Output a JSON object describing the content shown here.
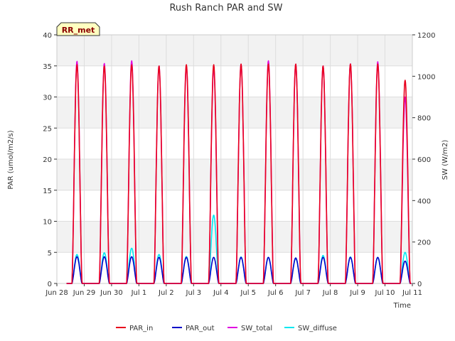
{
  "chart_data": {
    "type": "line",
    "title": "Rush Ranch PAR and SW",
    "badge": "RR_met",
    "xlabel": "Time",
    "ylabel_left": "PAR (umol/m2/s)",
    "ylabel_right": "SW (W/m2)",
    "ylim_left": [
      0,
      40
    ],
    "ylim_right": [
      0,
      1200
    ],
    "xlim_days": [
      0,
      13
    ],
    "yticks_left": [
      "0",
      "5",
      "10",
      "15",
      "20",
      "25",
      "30",
      "35",
      "40"
    ],
    "yticks_right": [
      "0",
      "200",
      "400",
      "600",
      "800",
      "1000",
      "1200"
    ],
    "xticks": [
      "Jun 28",
      "Jun 29",
      "Jun 30",
      "Jul 1",
      "Jul 2",
      "Jul 3",
      "Jul 4",
      "Jul 5",
      "Jul 6",
      "Jul 7",
      "Jul 8",
      "Jul 9",
      "Jul 10",
      "Jul 11"
    ],
    "grid": true,
    "legend_position": "bottom",
    "colors": {
      "PAR_in": "#e8001c",
      "PAR_out": "#0000c8",
      "SW_total": "#e000e0",
      "SW_diffuse": "#00e8f0",
      "band": "#f2f2f2",
      "grid": "#dddddd"
    },
    "series": [
      {
        "name": "PAR_in",
        "axis": "left",
        "daily_peak": [
          35.2,
          35.0,
          35.2,
          35.0,
          35.2,
          35.2,
          35.3,
          35.3,
          35.3,
          35.0,
          35.3,
          35.3,
          32.7
        ]
      },
      {
        "name": "PAR_out",
        "axis": "left",
        "daily_peak": [
          4.3,
          4.3,
          4.3,
          4.2,
          4.2,
          4.2,
          4.2,
          4.2,
          4.1,
          4.2,
          4.2,
          4.2,
          3.6
        ]
      },
      {
        "name": "SW_total",
        "axis": "right",
        "daily_peak": [
          1072,
          1062,
          1075,
          1050,
          1050,
          1040,
          1058,
          1075,
          1058,
          1050,
          1060,
          1070,
          900
        ]
      },
      {
        "name": "SW_diffuse",
        "axis": "right",
        "daily_peak": [
          140,
          148,
          170,
          140,
          130,
          330,
          128,
          125,
          120,
          135,
          128,
          125,
          150
        ]
      }
    ],
    "daily_sunrise_fraction": 0.55,
    "daily_sunset_fraction": 0.92
  }
}
